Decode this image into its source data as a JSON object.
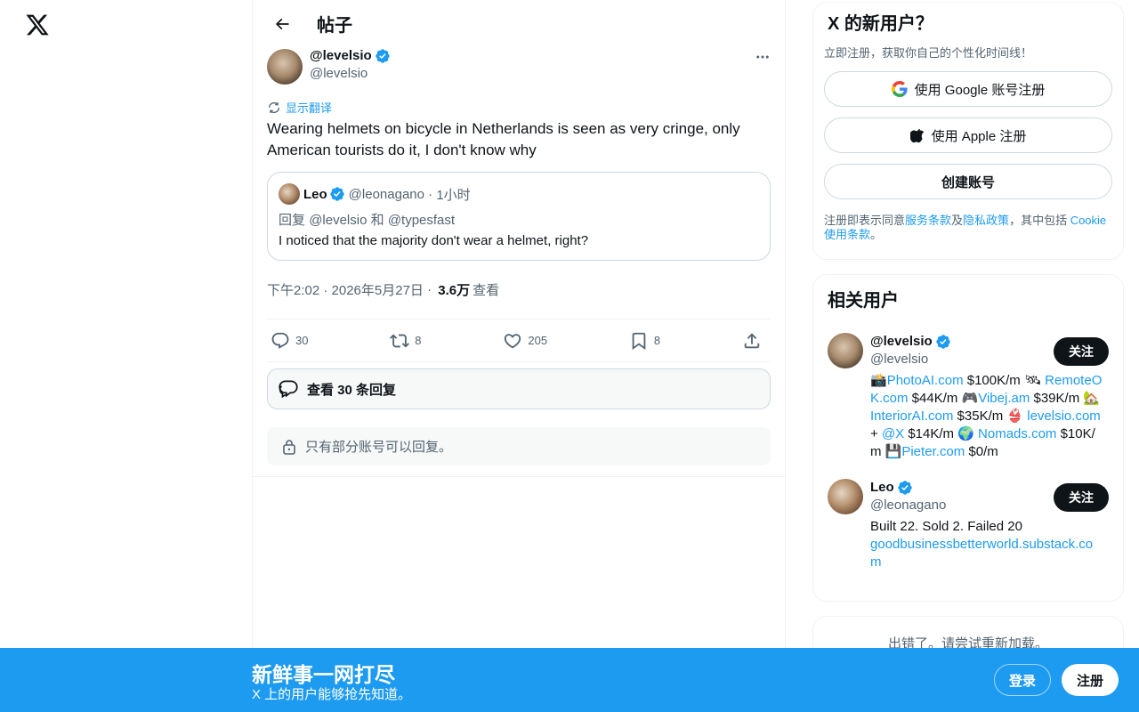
{
  "header": {
    "title": "帖子"
  },
  "post": {
    "author_name": "@levelsio",
    "author_handle": "@levelsio",
    "translate_label": "显示翻译",
    "text": "Wearing helmets on bicycle in Netherlands is seen as very cringe, only American tourists do it, I don't know why",
    "quote": {
      "name": "Leo",
      "handle": "@leonagano",
      "time": "1小时",
      "reply_prefix": "回复",
      "reply_to_1": "@levelsio",
      "reply_and": "和",
      "reply_to_2": "@typesfast",
      "text": "I noticed that the majority don't wear a helmet, right?"
    },
    "timestamp": "下午2:02 · 2026年5月27日",
    "views_count": "3.6万",
    "views_label": "查看",
    "actions": {
      "replies": "30",
      "reposts": "8",
      "likes": "205",
      "bookmarks": "8"
    },
    "view_replies_label": "查看 30 条回复",
    "restricted_label": "只有部分账号可以回复。"
  },
  "signup": {
    "title": "X 的新用户？",
    "subtitle": "立即注册，获取你自己的个性化时间线！",
    "google_label": "使用 Google 账号注册",
    "apple_label": "使用 Apple 注册",
    "create_label": "创建账号",
    "terms_prefix": "注册即表示同意",
    "terms_link": "服务条款",
    "terms_and": "及",
    "privacy_link": "隐私政策",
    "terms_mid": "，其中包括 ",
    "cookie_link": "Cookie 使用条款",
    "terms_end": "。"
  },
  "related": {
    "title": "相关用户",
    "users": [
      {
        "name": "@levelsio",
        "handle": "@levelsio",
        "follow_label": "关注",
        "bio": [
          {
            "t": "📸",
            "link": false
          },
          {
            "t": "PhotoAI.com",
            "link": true
          },
          {
            "t": " $100K/m 🛰 ",
            "link": false
          },
          {
            "t": "RemoteOK.com",
            "link": true
          },
          {
            "t": " $44K/m 🎮",
            "link": false
          },
          {
            "t": "Vibej.am",
            "link": true
          },
          {
            "t": " $39K/m 🏡",
            "link": false
          },
          {
            "t": "InteriorAI.com",
            "link": true
          },
          {
            "t": " $35K/m 👙 ",
            "link": false
          },
          {
            "t": "levelsio.com",
            "link": true
          },
          {
            "t": " + ",
            "link": false
          },
          {
            "t": "@X",
            "link": true
          },
          {
            "t": " $14K/m 🌍 ",
            "link": false
          },
          {
            "t": "Nomads.com",
            "link": true
          },
          {
            "t": " $10K/m 💾",
            "link": false
          },
          {
            "t": "Pieter.com",
            "link": true
          },
          {
            "t": " $0/m",
            "link": false
          }
        ]
      },
      {
        "name": "Leo",
        "handle": "@leonagano",
        "follow_label": "关注",
        "bio_text": "Built 22. Sold 2. Failed 20",
        "bio_link": "goodbusinessbetterworld.substack.com"
      }
    ]
  },
  "error_text": "出错了。请尝试重新加载。",
  "banner": {
    "title": "新鲜事一网打尽",
    "subtitle": "X 上的用户能够抢先知道。",
    "login_label": "登录",
    "register_label": "注册"
  },
  "colors": {
    "accent": "#1d9bf0",
    "text": "#0f1419",
    "muted": "#536471",
    "border": "#eff3f4"
  }
}
